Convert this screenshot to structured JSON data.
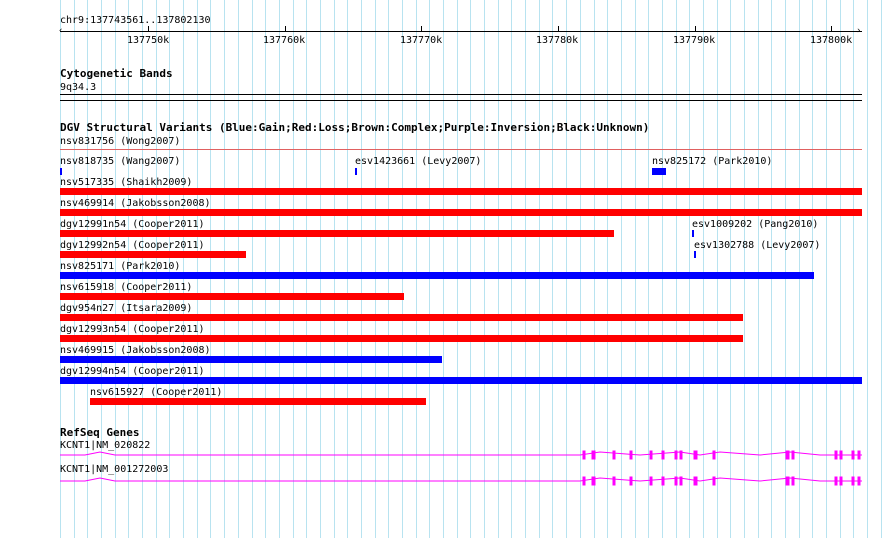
{
  "position": "chr9:137743561..137802130",
  "ruler": {
    "ticks": [
      "137750k",
      "137760k",
      "137770k",
      "137780k",
      "137790k",
      "137800k"
    ]
  },
  "cytoband": {
    "title": "Cytogenetic Bands",
    "band": "9q34.3"
  },
  "dgv": {
    "title": "DGV Structural Variants (Blue:Gain;Red:Loss;Brown:Complex;Purple:Inversion;Black:Unknown)",
    "colors": {
      "gain": "#0000ff",
      "loss": "#ff0000",
      "line": "#e06060"
    },
    "variants": [
      {
        "label": "nsv831756 (Wong2007)"
      },
      {
        "label": "nsv818735 (Wang2007)"
      },
      {
        "label": "esv1423661 (Levy2007)"
      },
      {
        "label": "nsv825172 (Park2010)"
      },
      {
        "label": "nsv517335 (Shaikh2009)"
      },
      {
        "label": "nsv469914 (Jakobsson2008)"
      },
      {
        "label": "dgv12991n54 (Cooper2011)"
      },
      {
        "label": "esv1009202 (Pang2010)"
      },
      {
        "label": "dgv12992n54 (Cooper2011)"
      },
      {
        "label": "esv1302788 (Levy2007)"
      },
      {
        "label": "nsv825171 (Park2010)"
      },
      {
        "label": "nsv615918 (Cooper2011)"
      },
      {
        "label": "dgv954n27 (Itsara2009)"
      },
      {
        "label": "dgv12993n54 (Cooper2011)"
      },
      {
        "label": "nsv469915 (Jakobsson2008)"
      },
      {
        "label": "dgv12994n54 (Cooper2011)"
      },
      {
        "label": "nsv615927 (Cooper2011)"
      }
    ]
  },
  "refseq": {
    "title": "RefSeq Genes",
    "color": "#ff00ff",
    "transcripts": [
      {
        "label": "KCNT1|NM_020822"
      },
      {
        "label": "KCNT1|NM_001272003"
      }
    ]
  }
}
